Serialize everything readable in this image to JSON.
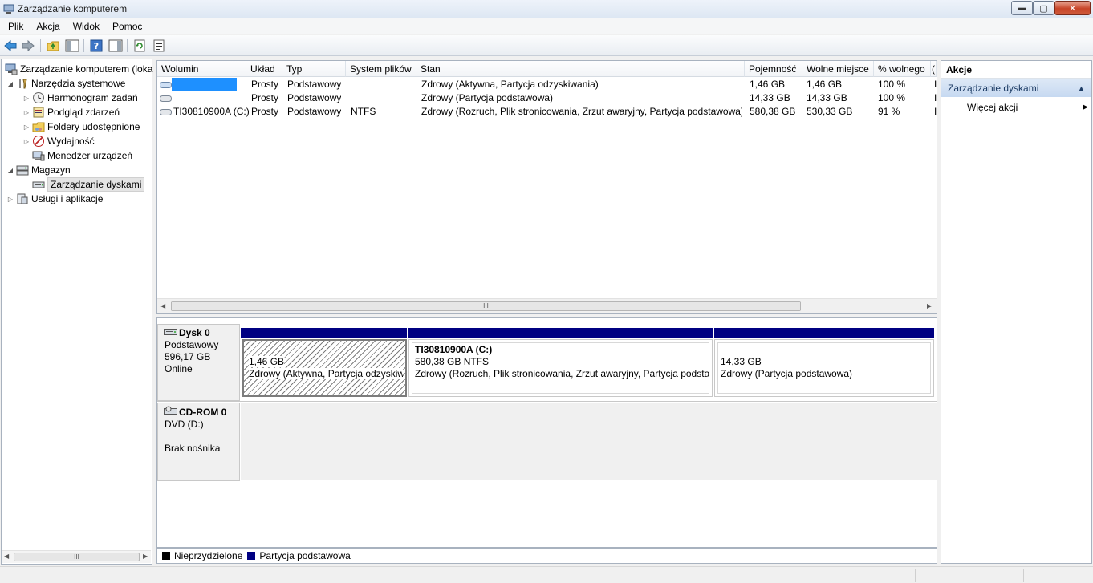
{
  "window": {
    "title": "Zarządzanie komputerem",
    "min_symbol": "▬",
    "max_symbol": "▢",
    "close_symbol": "✕"
  },
  "menu": [
    "Plik",
    "Akcja",
    "Widok",
    "Pomoc"
  ],
  "toolbar": {
    "icons": [
      "back-icon",
      "forward-icon",
      "up-folder-icon",
      "show-hide-tree-icon",
      "help-icon",
      "show-hide-action-pane-icon",
      "refresh-icon",
      "properties-icon"
    ]
  },
  "tree": {
    "items": [
      {
        "label": "Zarządzanie komputerem (loka",
        "icon": "computer-management-icon"
      },
      {
        "label": "Narzędzia systemowe",
        "icon": "system-tools-icon"
      },
      {
        "label": "Harmonogram zadań",
        "icon": "task-scheduler-icon"
      },
      {
        "label": "Podgląd zdarzeń",
        "icon": "event-viewer-icon"
      },
      {
        "label": "Foldery udostępnione",
        "icon": "shared-folders-icon"
      },
      {
        "label": "Wydajność",
        "icon": "performance-icon"
      },
      {
        "label": "Menedżer urządzeń",
        "icon": "device-manager-icon"
      },
      {
        "label": "Magazyn",
        "icon": "storage-icon"
      },
      {
        "label": "Zarządzanie dyskami",
        "icon": "disk-management-icon"
      },
      {
        "label": "Usługi i aplikacje",
        "icon": "services-apps-icon"
      }
    ]
  },
  "volumes": {
    "columns": [
      "Wolumin",
      "Układ",
      "Typ",
      "System plików",
      "Stan",
      "Pojemność",
      "Wolne miejsce",
      "% wolnego",
      "("
    ],
    "rows": [
      {
        "name": "",
        "layout": "Prosty",
        "type": "Podstawowy",
        "fs": "",
        "status": "Zdrowy (Aktywna, Partycja odzyskiwania)",
        "capacity": "1,46 GB",
        "free": "1,46 GB",
        "pct": "100 %",
        "extra": "I"
      },
      {
        "name": "",
        "layout": "Prosty",
        "type": "Podstawowy",
        "fs": "",
        "status": "Zdrowy (Partycja podstawowa)",
        "capacity": "14,33 GB",
        "free": "14,33 GB",
        "pct": "100 %",
        "extra": "I"
      },
      {
        "name": "TI30810900A (C:)",
        "layout": "Prosty",
        "type": "Podstawowy",
        "fs": "NTFS",
        "status": "Zdrowy (Rozruch, Plik stronicowania, Zrzut awaryjny, Partycja podstawowa)",
        "capacity": "580,38 GB",
        "free": "530,33 GB",
        "pct": "91 %",
        "extra": "I"
      }
    ],
    "hscroll_grip": "III"
  },
  "disks": [
    {
      "name": "Dysk 0",
      "type": "Podstawowy",
      "size": "596,17 GB",
      "state": "Online",
      "partitions": [
        {
          "title": "",
          "size": "1,46 GB",
          "status": "Zdrowy (Aktywna, Partycja odzyskiw"
        },
        {
          "title": "TI30810900A  (C:)",
          "size": "580,38 GB NTFS",
          "status": "Zdrowy (Rozruch, Plik stronicowania, Zrzut awaryjny, Partycja podstaw"
        },
        {
          "title": "",
          "size": "14,33 GB",
          "status": "Zdrowy (Partycja podstawowa)"
        }
      ]
    },
    {
      "name": "CD-ROM 0",
      "type": "DVD (D:)",
      "state": "Brak nośnika"
    }
  ],
  "legend": [
    {
      "label": "Nieprzydzielone",
      "color": "#000000"
    },
    {
      "label": "Partycja podstawowa",
      "color": "#000082"
    }
  ],
  "actions": {
    "header": "Akcje",
    "group": "Zarządzanie dyskami",
    "more": "Więcej akcji"
  },
  "tree_hscroll_grip": "III"
}
